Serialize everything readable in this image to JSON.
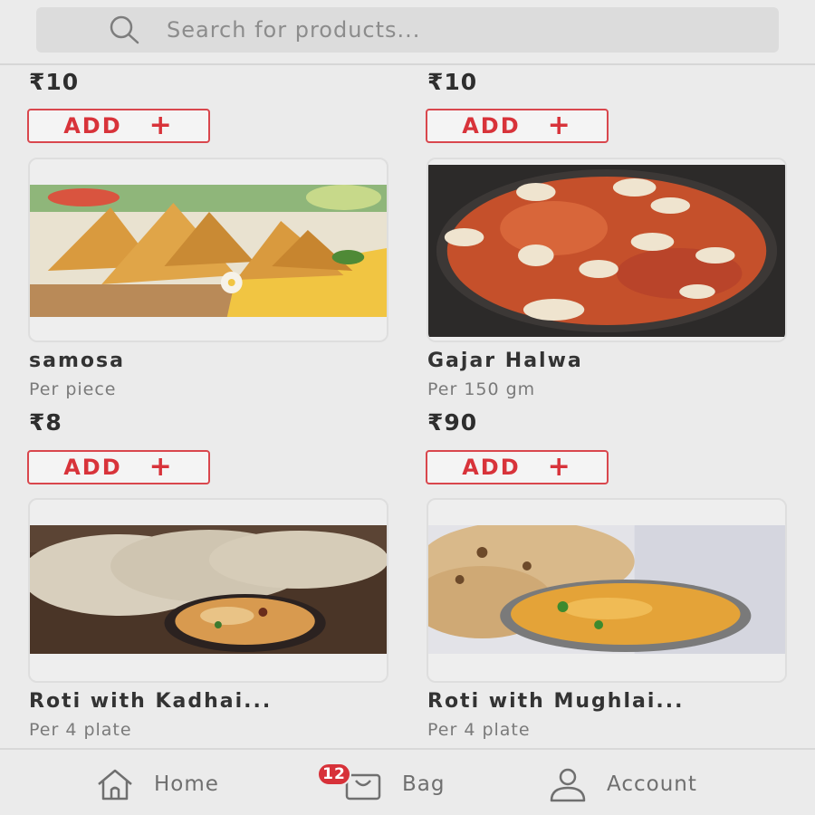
{
  "search": {
    "placeholder": "Search for products..."
  },
  "products": [
    {
      "name": "",
      "unit": "",
      "price": "₹10",
      "add_label": "ADD",
      "image": ""
    },
    {
      "name": "",
      "unit": "",
      "price": "₹10",
      "add_label": "ADD",
      "image": ""
    },
    {
      "name": "samosa",
      "unit": "Per piece",
      "price": "₹8",
      "add_label": "ADD",
      "image": "samosa-photo"
    },
    {
      "name": "Gajar Halwa",
      "unit": "Per 150 gm",
      "price": "₹90",
      "add_label": "ADD",
      "image": "gajar-halwa-photo"
    },
    {
      "name": "Roti with Kadhai...",
      "unit": "Per 4 plate",
      "price": "",
      "add_label": "",
      "image": "roti-kadhai-photo"
    },
    {
      "name": "Roti with Mughlai...",
      "unit": "Per 4 plate",
      "price": "",
      "add_label": "",
      "image": "roti-mughlai-photo"
    }
  ],
  "nav": {
    "home_label": "Home",
    "bag_label": "Bag",
    "bag_count": "12",
    "account_label": "Account"
  },
  "colors": {
    "accent": "#d8333a",
    "background": "#ebebeb"
  }
}
